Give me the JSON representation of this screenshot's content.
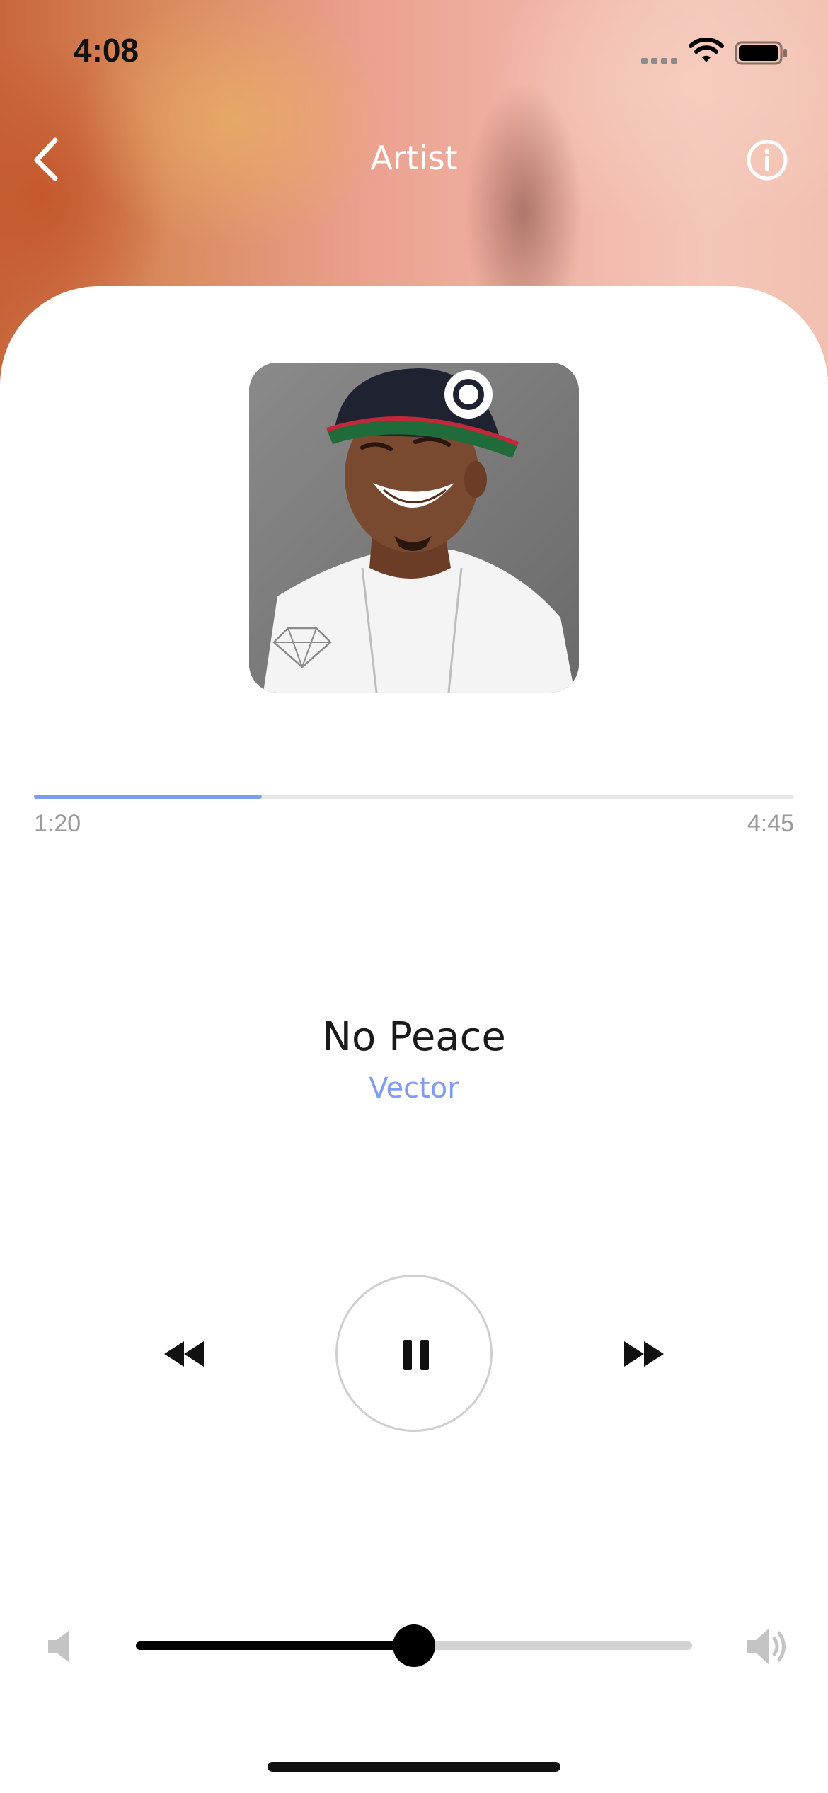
{
  "status_bar": {
    "time": "4:08"
  },
  "header": {
    "title": "Artist",
    "back_icon": "chevron-left-icon",
    "info_icon": "info-circle-icon"
  },
  "track": {
    "title": "No Peace",
    "artist": "Vector",
    "elapsed": "1:20",
    "duration": "4:45",
    "progress_fraction": 0.3
  },
  "volume": {
    "level_fraction": 0.5
  },
  "colors": {
    "accent": "#7e9cf0",
    "text_primary": "#1a1a1a",
    "text_secondary": "#9a9a9a"
  }
}
